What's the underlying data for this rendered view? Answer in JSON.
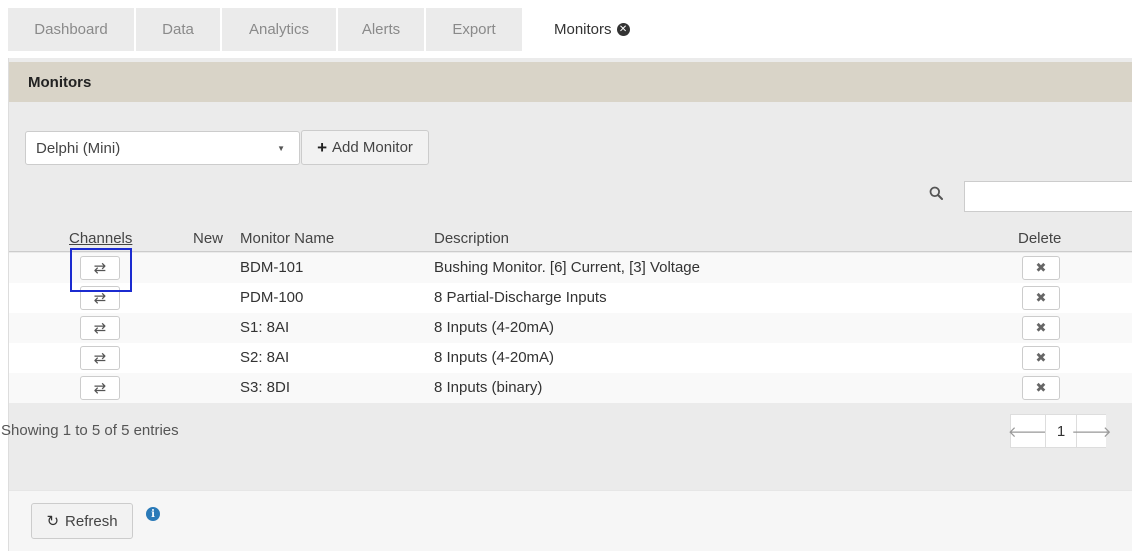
{
  "tabs": [
    {
      "label": "Dashboard"
    },
    {
      "label": "Data"
    },
    {
      "label": "Analytics"
    },
    {
      "label": "Alerts"
    },
    {
      "label": "Export"
    },
    {
      "label": "Monitors"
    }
  ],
  "panel": {
    "title": "Monitors"
  },
  "controls": {
    "selected_monitor_type": "Delphi (Mini)",
    "add_label": "Add Monitor",
    "search_value": ""
  },
  "table": {
    "headers": {
      "channels": "Channels",
      "new": "New",
      "name": "Monitor Name",
      "description": "Description",
      "delete": "Delete"
    },
    "rows": [
      {
        "name": "BDM-101",
        "description": "Bushing Monitor. [6] Current, [3] Voltage"
      },
      {
        "name": "PDM-100",
        "description": "8 Partial-Discharge Inputs"
      },
      {
        "name": "S1: 8AI",
        "description": "8 Inputs (4-20mA)"
      },
      {
        "name": "S2: 8AI",
        "description": "8 Inputs (4-20mA)"
      },
      {
        "name": "S3: 8DI",
        "description": "8 Inputs (binary)"
      }
    ]
  },
  "pagination": {
    "info": "Showing 1 to 5 of 5 entries",
    "current_page": "1"
  },
  "footer": {
    "refresh_label": "Refresh"
  },
  "colors": {
    "highlight": "#1b2bd0",
    "info": "#2a7ab8",
    "header_band": "#d9d4c8"
  },
  "icons": {
    "tab_close": "close-circle-icon",
    "add": "plus-icon",
    "search": "search-icon",
    "channels": "swap-arrows-icon",
    "delete": "times-icon",
    "prev": "arrow-left-icon",
    "next": "arrow-right-icon",
    "refresh": "refresh-icon",
    "info": "info-circle-icon"
  }
}
